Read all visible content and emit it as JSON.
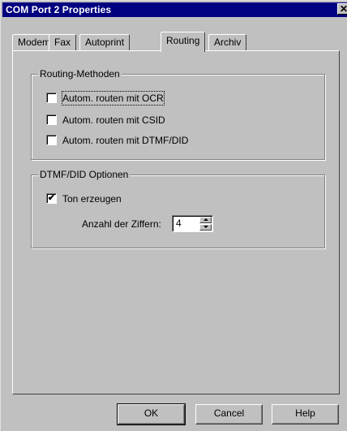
{
  "window": {
    "title": "COM Port 2 Properties",
    "close_glyph": "✕"
  },
  "tabs": [
    {
      "label": "Modem"
    },
    {
      "label": "Fax"
    },
    {
      "label": "Autoprint"
    },
    {
      "label": "Routing"
    },
    {
      "label": "Archiv"
    }
  ],
  "active_tab": "Routing",
  "routing_methods": {
    "legend": "Routing-Methoden",
    "options": [
      {
        "label": "Autom. routen mit OCR",
        "checked": false
      },
      {
        "label": "Autom. routen mit CSID",
        "checked": false
      },
      {
        "label": "Autom. routen mit DTMF/DID",
        "checked": false
      }
    ]
  },
  "dtmf_options": {
    "legend": "DTMF/DID Optionen",
    "tone": {
      "label": "Ton erzeugen",
      "checked": true,
      "mark": "✔"
    },
    "digits": {
      "label": "Anzahl der Ziffern:",
      "value": "4"
    }
  },
  "buttons": {
    "ok": "OK",
    "cancel": "Cancel",
    "help": "Help"
  }
}
